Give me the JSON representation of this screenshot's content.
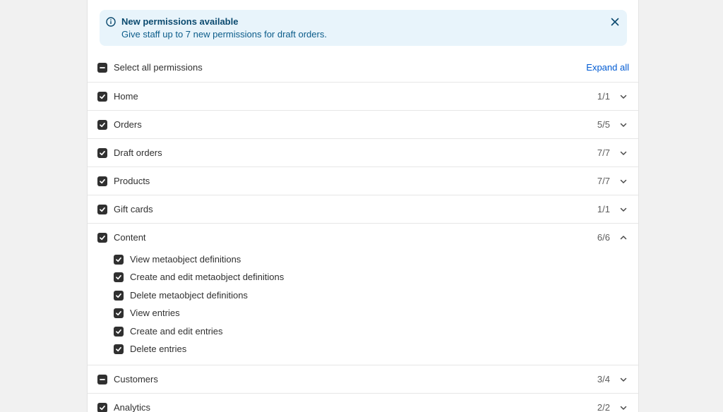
{
  "banner": {
    "title": "New permissions available",
    "text": "Give staff up to 7 new permissions for draft orders."
  },
  "select_all": {
    "label": "Select all permissions",
    "state": "indeterminate",
    "expand_all_label": "Expand all"
  },
  "sections": [
    {
      "label": "Home",
      "count": "1/1",
      "state": "checked",
      "expanded": false
    },
    {
      "label": "Orders",
      "count": "5/5",
      "state": "checked",
      "expanded": false
    },
    {
      "label": "Draft orders",
      "count": "7/7",
      "state": "checked",
      "expanded": false
    },
    {
      "label": "Products",
      "count": "7/7",
      "state": "checked",
      "expanded": false
    },
    {
      "label": "Gift cards",
      "count": "1/1",
      "state": "checked",
      "expanded": false
    },
    {
      "label": "Content",
      "count": "6/6",
      "state": "checked",
      "expanded": true,
      "items": [
        {
          "label": "View metaobject definitions",
          "checked": true
        },
        {
          "label": "Create and edit metaobject definitions",
          "checked": true
        },
        {
          "label": "Delete metaobject definitions",
          "checked": true
        },
        {
          "label": "View entries",
          "checked": true
        },
        {
          "label": "Create and edit entries",
          "checked": true
        },
        {
          "label": "Delete entries",
          "checked": true
        }
      ]
    },
    {
      "label": "Customers",
      "count": "3/4",
      "state": "indeterminate",
      "expanded": false
    },
    {
      "label": "Analytics",
      "count": "2/2",
      "state": "checked",
      "expanded": false
    }
  ],
  "colors": {
    "banner_bg": "#e8f4fb",
    "banner_title": "#0b4a6f",
    "checkbox": "#303030",
    "link": "#005bd3"
  },
  "icons": {
    "banner": "info-icon",
    "close": "close-icon",
    "collapsed": "chevron-down-icon",
    "expanded": "chevron-up-icon"
  }
}
